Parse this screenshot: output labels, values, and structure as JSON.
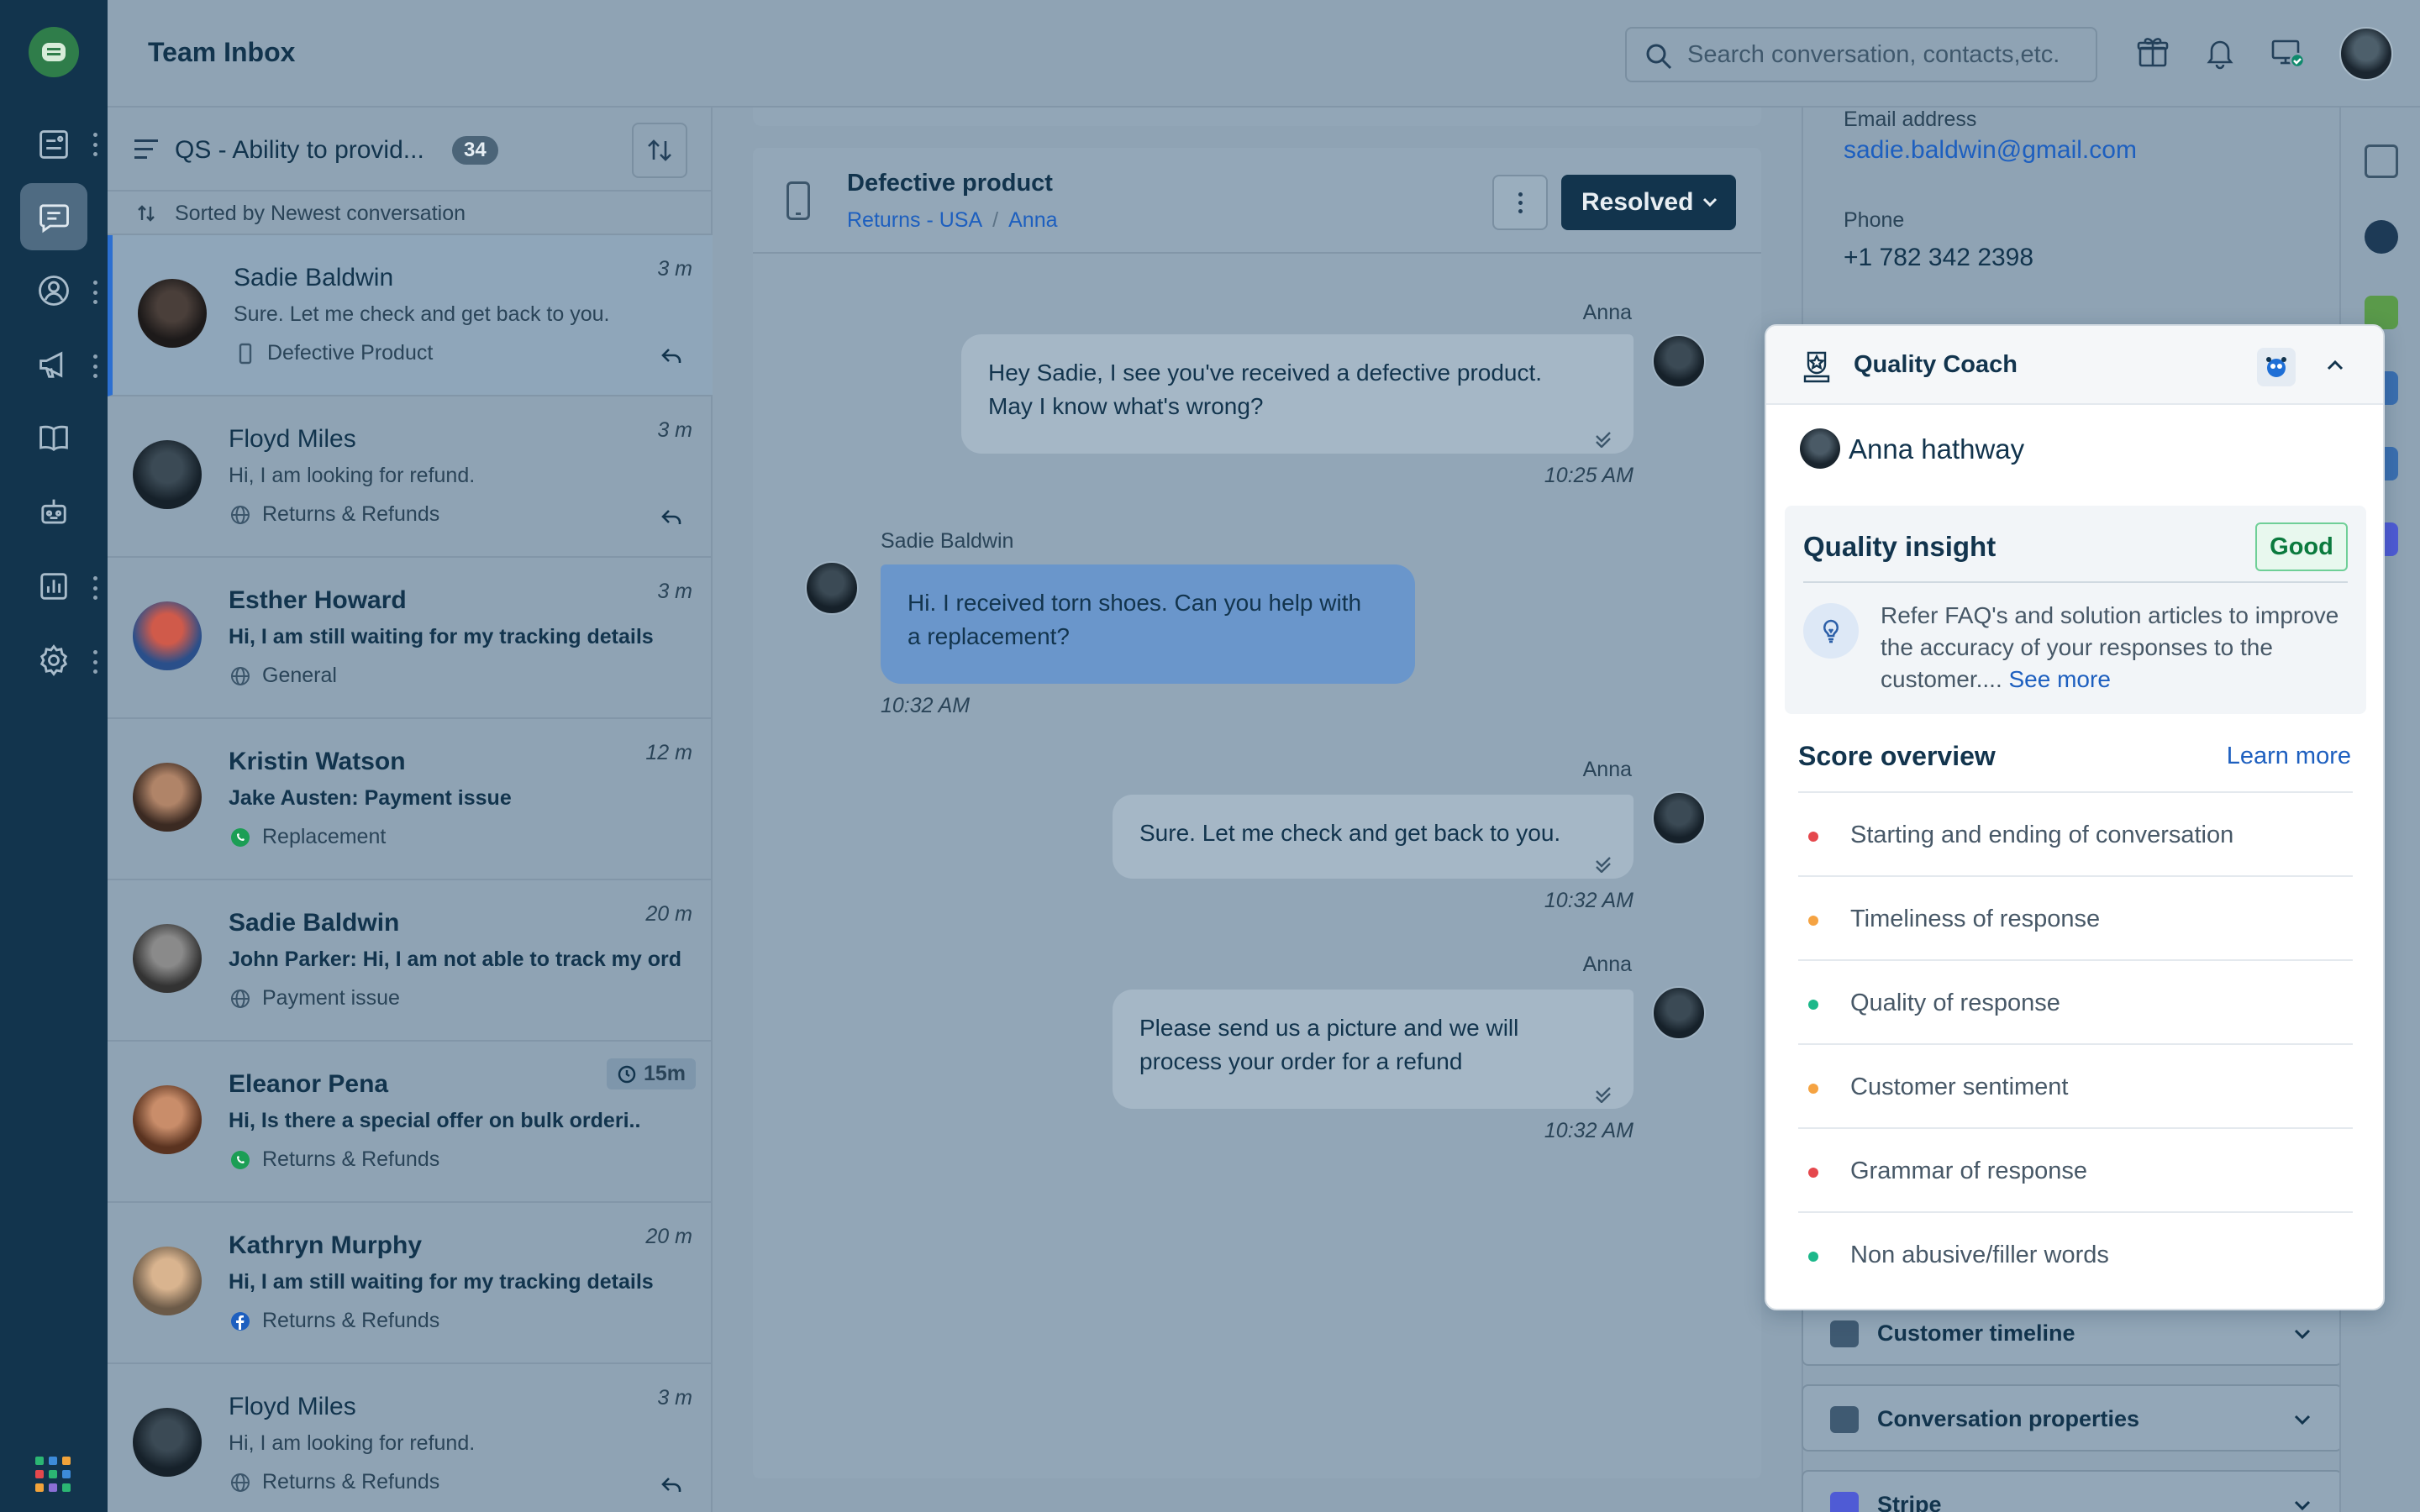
{
  "app": {
    "title": "Team Inbox"
  },
  "search": {
    "placeholder": "Search conversation, contacts,etc."
  },
  "sidebar": {
    "items": [
      "dashboard",
      "inbox",
      "contacts",
      "campaigns",
      "knowledge-base",
      "bots",
      "analytics",
      "settings"
    ],
    "active": "inbox"
  },
  "list": {
    "view_name": "QS - Ability to provid...",
    "count": "34",
    "sort_label": "Sorted by Newest conversation",
    "conversations": [
      {
        "name": "Sadie Baldwin",
        "message": "Sure. Let me check and get back to you.",
        "tag": "Defective Product",
        "tag_icon": "phone-icon",
        "time": "3 m",
        "bold": false,
        "replied": true,
        "selected": true
      },
      {
        "name": "Floyd Miles",
        "message": "Hi, I am looking for refund.",
        "tag": "Returns & Refunds",
        "tag_icon": "globe-icon",
        "time": "3 m",
        "bold": false,
        "replied": true
      },
      {
        "name": "Esther Howard",
        "message": "Hi, I am still waiting for my tracking details",
        "tag": "General",
        "tag_icon": "globe-icon",
        "time": "3 m",
        "bold": true,
        "replied": false
      },
      {
        "name": "Kristin Watson",
        "message": "Jake Austen: Payment issue",
        "tag": "Replacement",
        "tag_icon": "whatsapp-icon",
        "time": "12 m",
        "bold": true,
        "replied": false
      },
      {
        "name": "Sadie Baldwin",
        "message": "John Parker: Hi, I am not able to track my order",
        "tag": "Payment issue",
        "tag_icon": "globe-icon",
        "time": "20 m",
        "bold": true,
        "replied": false
      },
      {
        "name": "Eleanor Pena",
        "message": "Hi, Is there a special offer on bulk orderi..",
        "tag": "Returns & Refunds",
        "tag_icon": "whatsapp-icon",
        "time": "15m",
        "bold": true,
        "replied": false,
        "time_pill": true
      },
      {
        "name": "Kathryn Murphy",
        "message": "Hi, I am still waiting for my tracking details",
        "tag": "Returns & Refunds",
        "tag_icon": "facebook-icon",
        "time": "20 m",
        "bold": true,
        "replied": false
      },
      {
        "name": "Floyd Miles",
        "message": "Hi, I am looking for refund.",
        "tag": "Returns & Refunds",
        "tag_icon": "globe-icon",
        "time": "3 m",
        "bold": false,
        "replied": true
      }
    ]
  },
  "chat": {
    "subject": "Defective product",
    "breadcrumb": [
      "Returns - USA",
      "Anna"
    ],
    "status_button": "Resolved",
    "messages": [
      {
        "sender": "Anna",
        "direction": "out",
        "lines": [
          "Hey Sadie, I see you've received a defective product.",
          "May I know what's wrong?"
        ],
        "time": "10:25 AM"
      },
      {
        "sender": "Sadie Baldwin",
        "direction": "in",
        "lines": [
          "Hi. I received torn shoes. Can you help with",
          "a replacement?"
        ],
        "time": "10:32 AM"
      },
      {
        "sender": "Anna",
        "direction": "out",
        "lines": [
          "Sure. Let me check and get back to you."
        ],
        "time": "10:32 AM"
      },
      {
        "sender": "Anna",
        "direction": "out",
        "lines": [
          "Please send us a picture and we will",
          "process your order for a refund"
        ],
        "time": "10:32 AM"
      }
    ]
  },
  "contact": {
    "email_label": "Email address",
    "email": "sadie.baldwin@gmail.com",
    "phone_label": "Phone",
    "phone": "+1 782 342 2398",
    "sections": [
      "Customer timeline",
      "Conversation properties",
      "Stripe"
    ]
  },
  "quality_coach": {
    "title": "Quality Coach",
    "agent": "Anna hathway",
    "insight_title": "Quality insight",
    "rating": "Good",
    "insight_text": "Refer FAQ's and solution articles to improve the accuracy of your responses to the customer....",
    "see_more": "See more",
    "score_title": "Score overview",
    "learn_more": "Learn more",
    "scores": [
      {
        "label": "Starting and ending of conversation",
        "status_color": "#e5484d"
      },
      {
        "label": "Timeliness of response",
        "status_color": "#f5a342"
      },
      {
        "label": "Quality of response",
        "status_color": "#1cb88a"
      },
      {
        "label": "Customer sentiment",
        "status_color": "#f5a342"
      },
      {
        "label": "Grammar of response",
        "status_color": "#e5484d"
      },
      {
        "label": "Non abusive/filler words",
        "status_color": "#1cb88a"
      }
    ]
  },
  "colors": {
    "rail": "#12344d",
    "accent": "#2c6fd1",
    "good": "#0b7a3e"
  }
}
